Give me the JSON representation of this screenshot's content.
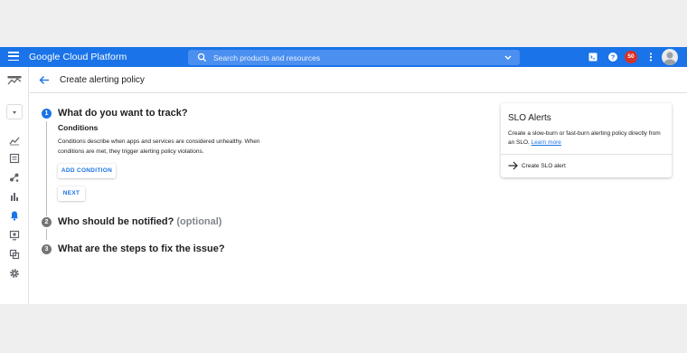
{
  "topbar": {
    "brand": "Google Cloud Platform",
    "search_placeholder": "Search products and resources",
    "notification_count": "50",
    "icons": [
      "menu-icon",
      "search-icon",
      "chevron-down-icon",
      "cloud-shell-icon",
      "help-icon",
      "more-vert-icon",
      "account-icon"
    ]
  },
  "sidebar": {
    "icons": [
      "monitoring-logo-icon",
      "project-dropdown-icon",
      "metrics-explorer-icon",
      "dashboards-icon",
      "services-icon",
      "bar-chart-icon",
      "alerting-icon",
      "uptime-checks-icon",
      "groups-icon",
      "settings-icon"
    ],
    "active": "alerting-icon"
  },
  "header": {
    "title": "Create alerting policy"
  },
  "steps": [
    {
      "number": "1",
      "title": "What do you want to track?",
      "optional": ""
    },
    {
      "number": "2",
      "title": "Who should be notified?",
      "optional": "(optional)"
    },
    {
      "number": "3",
      "title": "What are the steps to fix the issue?",
      "optional": ""
    }
  ],
  "conditions": {
    "title": "Conditions",
    "description": "Conditions describe when apps and services are considered unhealthy. When conditions are met, they trigger alerting policy violations.",
    "add_button": "ADD CONDITION",
    "next_button": "NEXT"
  },
  "slo_card": {
    "title": "SLO Alerts",
    "description": "Create a slow-burn or fast-burn alerting policy directly from an SLO.",
    "link": "Learn more",
    "action": "Create SLO alert"
  },
  "colors": {
    "accent": "#1a73e8",
    "badge": "#d93025",
    "step_inactive": "#757575"
  }
}
